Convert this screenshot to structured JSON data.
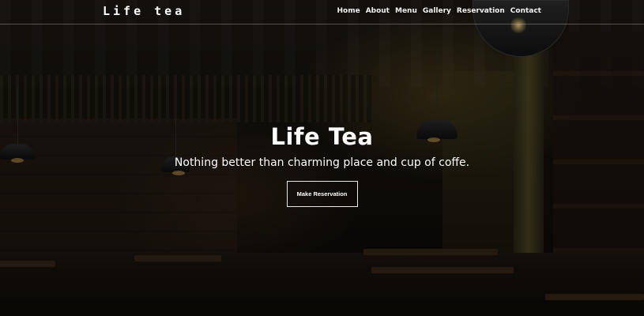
{
  "brand": {
    "name": "Life tea"
  },
  "nav": {
    "items": [
      {
        "label": "Home"
      },
      {
        "label": "About"
      },
      {
        "label": "Menu"
      },
      {
        "label": "Gallery"
      },
      {
        "label": "Reservation"
      },
      {
        "label": "Contact"
      }
    ]
  },
  "hero": {
    "title": "Life Tea",
    "subtitle": "Nothing better than charming place and cup of coffe.",
    "cta_label": "Make Reservation",
    "background": "restaurant-interior-photo"
  },
  "colors": {
    "text": "#ffffff",
    "overlay": "#000000",
    "divider": "#ffffff"
  }
}
